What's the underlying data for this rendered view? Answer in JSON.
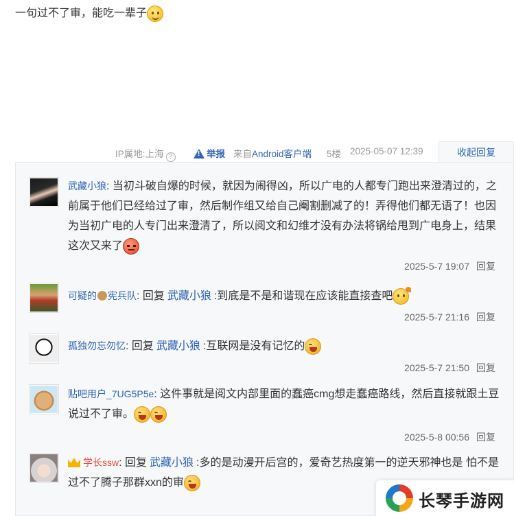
{
  "post": {
    "text": "一句过不了审，能吃一辈子"
  },
  "meta": {
    "ip_location": "IP属地:上海",
    "report_label": "举报",
    "source": "来自Android客户端",
    "floor": "5楼",
    "datetime": "2025-05-07 12:39",
    "collapse_label": "收起回复"
  },
  "replies": [
    {
      "username": "武藏小狼",
      "text": "当初斗破自爆的时候，就因为闹得凶，所以广电的人都专门跑出来澄清过的，之前属于他们已经给过了审，然后制作组又给自己阉割删减了的！弄得他们都无语了！也因为当初广电的人专门出来澄清了，所以阅文和幻维才没有办法将锅给甩到广电身上，结果这次又来了",
      "time": "2025-5-7 19:07",
      "reply_btn": "回复"
    },
    {
      "username_a": "可疑的",
      "username_b": "宪兵队",
      "reply_kw": "回复",
      "target": "武藏小狼",
      "text": ":到底是不是和谐现在应该能直接查吧",
      "time": "2025-5-7 21:16",
      "reply_btn": "回复"
    },
    {
      "username": "孤独勿忘勿忆",
      "reply_kw": "回复",
      "target": "武藏小狼",
      "text": ":互联网是没有记忆的",
      "time": "2025-5-7 21:50",
      "reply_btn": "回复"
    },
    {
      "username": "贴吧用户_7UG5P5e",
      "text": "这件事就是阅文内部里面的蠢癌cmg想走蠢癌路线，然后直接就跟土豆说过不了审。",
      "time": "2025-5-8 00:56",
      "reply_btn": "回复"
    },
    {
      "username": "学长ssw",
      "reply_kw": "回复",
      "target": "武藏小狼",
      "text": ":多的是动漫开后宫的，爱奇艺热度第一的逆天邪神也是 怕不是过不了腾子那群xxn的审"
    }
  ],
  "watermark": {
    "text": "长琴手游网"
  }
}
